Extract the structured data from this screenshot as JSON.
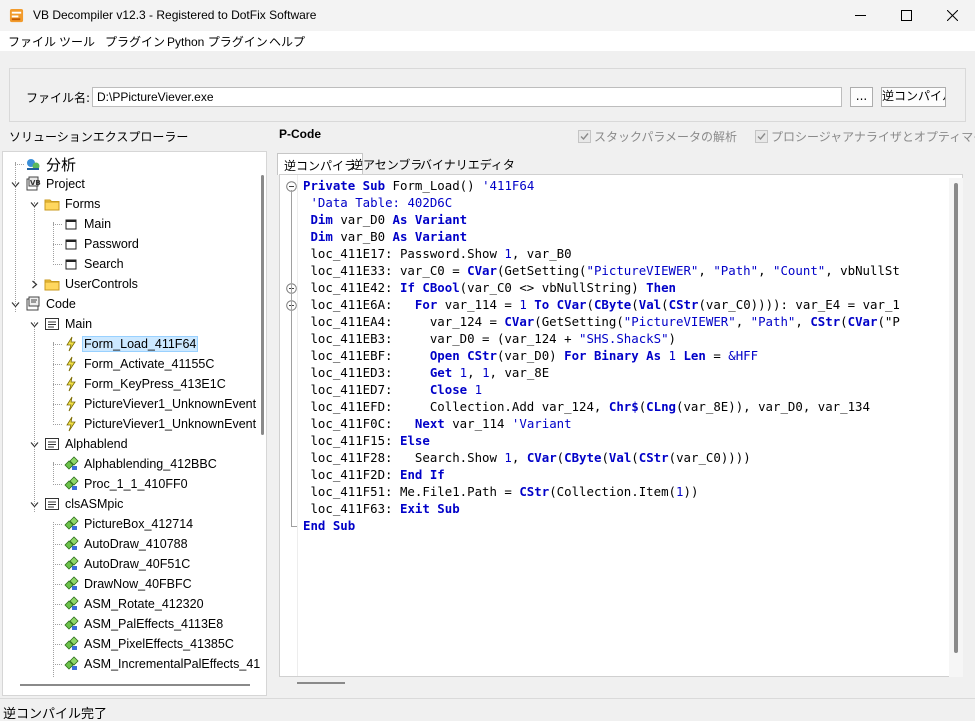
{
  "window": {
    "title": "VB Decompiler v12.3 - Registered to DotFix Software"
  },
  "menu": [
    "ファイル",
    "ツール",
    "プラグイン",
    "Python プラグイン",
    "ヘルプ"
  ],
  "file": {
    "label": "ファイル名:",
    "path": "D:\\PPictureViever.exe",
    "browse_label": "...",
    "decompile_label": "逆コンパイル"
  },
  "solution_explorer_label": "ソリューションエクスプローラー",
  "pcode_label": "P-Code",
  "options": {
    "stack_params": "スタックパラメータの解析",
    "proc_analyzer": "プロシージャアナライザとオプティマイザ"
  },
  "tabs": [
    "逆コンパイラ",
    "逆アセンブラ",
    "バイナリエディタ"
  ],
  "tree": [
    {
      "label": "分析",
      "icon": "analysis-icon",
      "level": 0,
      "big": true
    },
    {
      "label": "Project",
      "icon": "project-icon",
      "level": 0,
      "expand": true
    },
    {
      "label": "Forms",
      "icon": "folder-icon",
      "level": 1,
      "expand": true
    },
    {
      "label": "Main",
      "icon": "form-icon",
      "level": 2
    },
    {
      "label": "Password",
      "icon": "form-icon",
      "level": 2
    },
    {
      "label": "Search",
      "icon": "form-icon",
      "level": 2
    },
    {
      "label": "UserControls",
      "icon": "folder-icon",
      "level": 1,
      "collapsed": true
    },
    {
      "label": "Code",
      "icon": "code-icon",
      "level": 0,
      "expand": true
    },
    {
      "label": "Main",
      "icon": "module-icon",
      "level": 1,
      "expand": true
    },
    {
      "label": "Form_Load_411F64",
      "icon": "event-icon",
      "level": 2,
      "selected": true
    },
    {
      "label": "Form_Activate_41155C",
      "icon": "event-icon",
      "level": 2
    },
    {
      "label": "Form_KeyPress_413E1C",
      "icon": "event-icon",
      "level": 2
    },
    {
      "label": "PictureViever1_UnknownEvent",
      "icon": "event-icon",
      "level": 2
    },
    {
      "label": "PictureViever1_UnknownEvent",
      "icon": "event-icon",
      "level": 2
    },
    {
      "label": "Alphablend",
      "icon": "module-icon",
      "level": 1,
      "expand": true
    },
    {
      "label": "Alphablending_412BBC",
      "icon": "proc-icon",
      "level": 2
    },
    {
      "label": "Proc_1_1_410FF0",
      "icon": "proc-icon",
      "level": 2
    },
    {
      "label": "clsASMpic",
      "icon": "module-icon",
      "level": 1,
      "expand": true
    },
    {
      "label": "PictureBox_412714",
      "icon": "proc-icon",
      "level": 2
    },
    {
      "label": "AutoDraw_410788",
      "icon": "proc-icon",
      "level": 2
    },
    {
      "label": "AutoDraw_40F51C",
      "icon": "proc-icon",
      "level": 2
    },
    {
      "label": "DrawNow_40FBFC",
      "icon": "proc-icon",
      "level": 2
    },
    {
      "label": "ASM_Rotate_412320",
      "icon": "proc-icon",
      "level": 2
    },
    {
      "label": "ASM_PalEffects_4113E8",
      "icon": "proc-icon",
      "level": 2
    },
    {
      "label": "ASM_PixelEffects_41385C",
      "icon": "proc-icon",
      "level": 2
    },
    {
      "label": "ASM_IncrementalPalEffects_41",
      "icon": "proc-icon",
      "level": 2
    }
  ],
  "code": [
    [
      {
        "t": "Private Sub ",
        "c": "kw"
      },
      {
        "t": "Form_Load() "
      },
      {
        "t": "'411F64",
        "c": "cm"
      }
    ],
    [
      {
        "t": " "
      },
      {
        "t": "'Data Table: 402D6C",
        "c": "cm"
      }
    ],
    [
      {
        "t": " "
      },
      {
        "t": "Dim ",
        "c": "kw"
      },
      {
        "t": "var_D0 "
      },
      {
        "t": "As Variant",
        "c": "kw"
      }
    ],
    [
      {
        "t": " "
      },
      {
        "t": "Dim ",
        "c": "kw"
      },
      {
        "t": "var_B0 "
      },
      {
        "t": "As Variant",
        "c": "kw"
      }
    ],
    [
      {
        "t": " loc_411E17: Password.Show "
      },
      {
        "t": "1",
        "c": "num"
      },
      {
        "t": ", var_B0"
      }
    ],
    [
      {
        "t": " loc_411E33: var_C0 = "
      },
      {
        "t": "CVar",
        "c": "kw"
      },
      {
        "t": "(GetSetting("
      },
      {
        "t": "\"PictureVIEWER\"",
        "c": "str"
      },
      {
        "t": ", "
      },
      {
        "t": "\"Path\"",
        "c": "str"
      },
      {
        "t": ", "
      },
      {
        "t": "\"Count\"",
        "c": "str"
      },
      {
        "t": ", vbNullSt"
      }
    ],
    [
      {
        "t": " loc_411E42: "
      },
      {
        "t": "If CBool",
        "c": "kw"
      },
      {
        "t": "(var_C0 <> vbNullString) "
      },
      {
        "t": "Then",
        "c": "kw"
      }
    ],
    [
      {
        "t": " loc_411E6A:   "
      },
      {
        "t": "For ",
        "c": "kw"
      },
      {
        "t": "var_114 = "
      },
      {
        "t": "1 ",
        "c": "num"
      },
      {
        "t": "To CVar",
        "c": "kw"
      },
      {
        "t": "("
      },
      {
        "t": "CByte",
        "c": "kw"
      },
      {
        "t": "("
      },
      {
        "t": "Val",
        "c": "kw"
      },
      {
        "t": "("
      },
      {
        "t": "CStr",
        "c": "kw"
      },
      {
        "t": "(var_C0)))): var_E4 = var_1"
      }
    ],
    [
      {
        "t": " loc_411EA4:     var_124 = "
      },
      {
        "t": "CVar",
        "c": "kw"
      },
      {
        "t": "(GetSetting("
      },
      {
        "t": "\"PictureVIEWER\"",
        "c": "str"
      },
      {
        "t": ", "
      },
      {
        "t": "\"Path\"",
        "c": "str"
      },
      {
        "t": ", "
      },
      {
        "t": "CStr",
        "c": "kw"
      },
      {
        "t": "("
      },
      {
        "t": "CVar",
        "c": "kw"
      },
      {
        "t": "(\"P"
      }
    ],
    [
      {
        "t": " loc_411EB3:     var_D0 = (var_124 + "
      },
      {
        "t": "\"SHS.ShackS\"",
        "c": "str"
      },
      {
        "t": ")"
      }
    ],
    [
      {
        "t": " loc_411EBF:     "
      },
      {
        "t": "Open CStr",
        "c": "kw"
      },
      {
        "t": "(var_D0) "
      },
      {
        "t": "For Binary As ",
        "c": "kw"
      },
      {
        "t": "1 ",
        "c": "num"
      },
      {
        "t": "Len ",
        "c": "kw"
      },
      {
        "t": "= "
      },
      {
        "t": "&HFF",
        "c": "num"
      }
    ],
    [
      {
        "t": " loc_411ED3:     "
      },
      {
        "t": "Get ",
        "c": "kw"
      },
      {
        "t": "1",
        "c": "num"
      },
      {
        "t": ", "
      },
      {
        "t": "1",
        "c": "num"
      },
      {
        "t": ", var_8E"
      }
    ],
    [
      {
        "t": " loc_411ED7:     "
      },
      {
        "t": "Close ",
        "c": "kw"
      },
      {
        "t": "1",
        "c": "num"
      }
    ],
    [
      {
        "t": " loc_411EFD:     Collection.Add var_124, "
      },
      {
        "t": "Chr$",
        "c": "kw"
      },
      {
        "t": "("
      },
      {
        "t": "CLng",
        "c": "kw"
      },
      {
        "t": "(var_8E)), var_D0, var_134"
      }
    ],
    [
      {
        "t": " loc_411F0C:   "
      },
      {
        "t": "Next ",
        "c": "kw"
      },
      {
        "t": "var_114 "
      },
      {
        "t": "'Variant",
        "c": "cm"
      }
    ],
    [
      {
        "t": " loc_411F15: "
      },
      {
        "t": "Else",
        "c": "kw"
      }
    ],
    [
      {
        "t": " loc_411F28:   Search.Show "
      },
      {
        "t": "1",
        "c": "num"
      },
      {
        "t": ", "
      },
      {
        "t": "CVar",
        "c": "kw"
      },
      {
        "t": "("
      },
      {
        "t": "CByte",
        "c": "kw"
      },
      {
        "t": "("
      },
      {
        "t": "Val",
        "c": "kw"
      },
      {
        "t": "("
      },
      {
        "t": "CStr",
        "c": "kw"
      },
      {
        "t": "(var_C0))))"
      }
    ],
    [
      {
        "t": " loc_411F2D: "
      },
      {
        "t": "End If",
        "c": "kw"
      }
    ],
    [
      {
        "t": " loc_411F51: Me.File1.Path = "
      },
      {
        "t": "CStr",
        "c": "kw"
      },
      {
        "t": "(Collection.Item("
      },
      {
        "t": "1",
        "c": "num"
      },
      {
        "t": "))"
      }
    ],
    [
      {
        "t": " loc_411F63: "
      },
      {
        "t": "Exit Sub",
        "c": "kw"
      }
    ],
    [
      {
        "t": "End Sub",
        "c": "kw"
      }
    ]
  ],
  "status": "逆コンパイル完了",
  "colors": {
    "keyword": "#0000c8",
    "selection": "#cce8ff"
  }
}
